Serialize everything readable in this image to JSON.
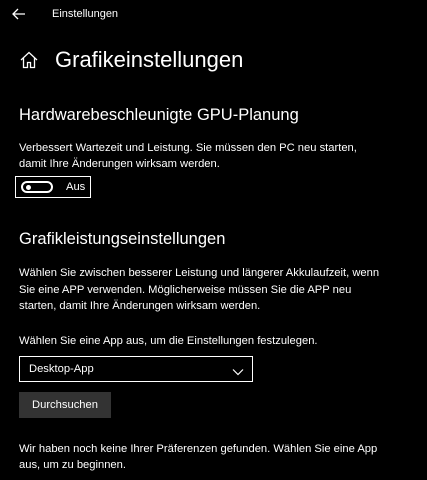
{
  "window": {
    "title": "Einstellungen",
    "back_icon": "arrow-left-icon"
  },
  "header": {
    "icon": "home-icon",
    "title": "Grafikeinstellungen"
  },
  "gpu_scheduling": {
    "heading": "Hardwarebeschleunigte GPU-Planung",
    "description_line1": "Verbessert Wartezeit und Leistung. Sie müssen den PC neu starten,",
    "description_line2": "damit Ihre Änderungen wirksam werden.",
    "toggle": {
      "state": "off",
      "label": "Aus"
    }
  },
  "performance": {
    "heading": "Grafikleistungseinstellungen",
    "description_line1": "Wählen Sie zwischen besserer Leistung und längerer Akkulaufzeit, wenn",
    "description_line2": "Sie eine APP verwenden. Möglicherweise müssen Sie die APP neu",
    "description_line3": "starten, damit Ihre Änderungen wirksam werden.",
    "select_prompt": "Wählen Sie eine App aus, um die Einstellungen festzulegen.",
    "dropdown": {
      "selected": "Desktop-App",
      "icon": "chevron-down-icon"
    },
    "browse_label": "Durchsuchen",
    "empty_line1": "Wir haben noch keine Ihrer Präferenzen gefunden. Wählen Sie eine App",
    "empty_line2": "aus, um zu beginnen."
  },
  "colors": {
    "background": "#000000",
    "text": "#ffffff",
    "button_bg": "#333333"
  }
}
